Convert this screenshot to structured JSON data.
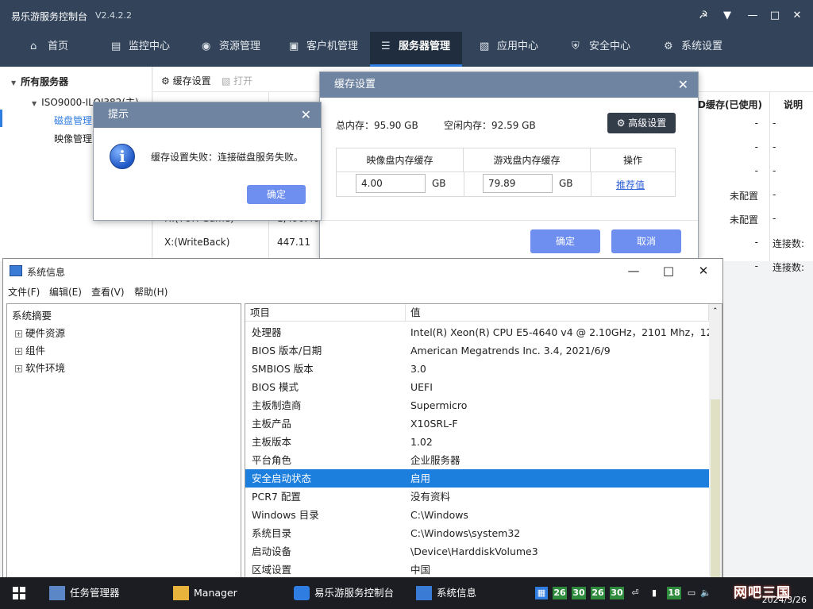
{
  "app": {
    "title": "易乐游服务控制台",
    "version": "V2.4.2.2",
    "nav": [
      {
        "label": "首页",
        "icon": "home-icon"
      },
      {
        "label": "监控中心",
        "icon": "monitor-chart-icon"
      },
      {
        "label": "资源管理",
        "icon": "gamepad-icon"
      },
      {
        "label": "客户机管理",
        "icon": "computer-icon"
      },
      {
        "label": "服务器管理",
        "icon": "server-icon"
      },
      {
        "label": "应用中心",
        "icon": "bag-icon"
      },
      {
        "label": "安全中心",
        "icon": "shield-icon"
      },
      {
        "label": "系统设置",
        "icon": "gear-icon"
      }
    ],
    "sidebar": {
      "root": "所有服务器",
      "server": "ISO9000-ILOJ382(主)",
      "items": [
        "磁盘管理",
        "映像管理"
      ]
    },
    "toolbar": {
      "cache": "缓存设置",
      "open": "打开"
    },
    "bg_table": {
      "right_headers": [
        "D缓存(已使用)",
        "说明"
      ],
      "rows": [
        {
          "name": "",
          "size": "",
          "c1": "-",
          "c2": "-"
        },
        {
          "name": "",
          "size": "",
          "c1": "-",
          "c2": "-"
        },
        {
          "name": "",
          "size": "",
          "c1": "-",
          "c2": "-"
        },
        {
          "name": "",
          "size": "",
          "c1": "未配置",
          "c2": "-"
        },
        {
          "name": "H:(TOH Game)",
          "size": "1,490.40",
          "c1": "未配置",
          "c2": "-"
        },
        {
          "name": "X:(WriteBack)",
          "size": "447.11",
          "c1": "-",
          "c2": "连接数:"
        },
        {
          "name": "",
          "size": "",
          "c1": "-",
          "c2": "连接数:"
        }
      ]
    }
  },
  "cache_dialog": {
    "title": "缓存设置",
    "total_mem_label": "总内存：",
    "total_mem": "95.90 GB",
    "free_mem_label": "空闲内存：",
    "free_mem": "92.59 GB",
    "advanced_btn": "高级设置",
    "headers": [
      "映像盘内存缓存",
      "游戏盘内存缓存",
      "操作"
    ],
    "image_cache": "4.00",
    "game_cache": "79.89",
    "unit": "GB",
    "recommend": "推荐值",
    "ok": "确定",
    "cancel": "取消"
  },
  "alert": {
    "title": "提示",
    "message": "缓存设置失败：连接磁盘服务失败。",
    "ok": "确定"
  },
  "sysinfo": {
    "title": "系统信息",
    "menus": [
      "文件(F)",
      "编辑(E)",
      "查看(V)",
      "帮助(H)"
    ],
    "tree": {
      "root": "系统摘要",
      "children": [
        "硬件资源",
        "组件",
        "软件环境"
      ]
    },
    "columns": [
      "项目",
      "值"
    ],
    "rows": [
      {
        "k": "处理器",
        "v": "Intel(R) Xeon(R) CPU E5-4640 v4 @ 2.10GHz，2101 Mhz，12"
      },
      {
        "k": "BIOS 版本/日期",
        "v": "American Megatrends Inc. 3.4, 2021/6/9"
      },
      {
        "k": "SMBIOS 版本",
        "v": "3.0"
      },
      {
        "k": "BIOS 模式",
        "v": "UEFI"
      },
      {
        "k": "主板制造商",
        "v": "Supermicro"
      },
      {
        "k": "主板产品",
        "v": "X10SRL-F"
      },
      {
        "k": "主板版本",
        "v": "1.02"
      },
      {
        "k": "平台角色",
        "v": "企业服务器"
      },
      {
        "k": "安全启动状态",
        "v": "启用"
      },
      {
        "k": "PCR7 配置",
        "v": "没有资料"
      },
      {
        "k": "Windows 目录",
        "v": "C:\\Windows"
      },
      {
        "k": "系统目录",
        "v": "C:\\Windows\\system32"
      },
      {
        "k": "启动设备",
        "v": "\\Device\\HarddiskVolume3"
      },
      {
        "k": "区域设置",
        "v": "中国"
      }
    ],
    "selected_row": 8
  },
  "taskbar": {
    "items": [
      "任务管理器",
      "Manager",
      "易乐游服务控制台",
      "系统信息"
    ],
    "tray_nums": [
      "26",
      "30",
      "26",
      "30",
      "18"
    ],
    "watermark": "网吧三国",
    "date": "2024/3/26"
  },
  "colors": {
    "navy": "#33445a",
    "accent": "#2f7de1",
    "dialog_header": "#6f84a1",
    "button_blue": "#6e8ff0",
    "selection": "#1c7fde"
  }
}
